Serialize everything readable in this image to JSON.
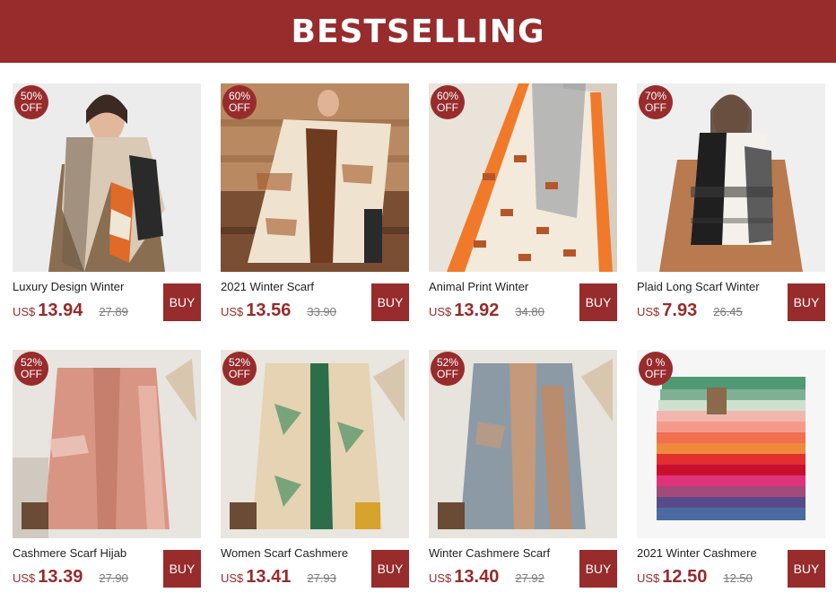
{
  "banner": {
    "title": "BESTSELLING"
  },
  "currency": "US$",
  "buy_label": "BUY",
  "colors": {
    "brand": "#982b2b"
  },
  "products": [
    {
      "badge_pct": "50%",
      "badge_off": "OFF",
      "title": "Luxury Design Winter",
      "price": "13.94",
      "original": "27.89",
      "image": "houndstooth-scarf-model"
    },
    {
      "badge_pct": "60%",
      "badge_off": "OFF",
      "title": "2021 Winter Scarf",
      "price": "13.56",
      "original": "33.90",
      "image": "horse-print-scarf-stairs"
    },
    {
      "badge_pct": "60%",
      "badge_off": "OFF",
      "title": "Animal Print Winter",
      "price": "13.92",
      "original": "34.80",
      "image": "animal-print-scarf"
    },
    {
      "badge_pct": "70%",
      "badge_off": "OFF",
      "title": "Plaid Long Scarf Winter",
      "price": "7.93",
      "original": "26.45",
      "image": "plaid-scarf-model"
    },
    {
      "badge_pct": "52%",
      "badge_off": "OFF",
      "title": "Cashmere Scarf Hijab",
      "price": "13.39",
      "original": "27.90",
      "image": "pink-cashmere-scarf"
    },
    {
      "badge_pct": "52%",
      "badge_off": "OFF",
      "title": "Women Scarf Cashmere",
      "price": "13.41",
      "original": "27.93",
      "image": "green-floral-scarf"
    },
    {
      "badge_pct": "52%",
      "badge_off": "OFF",
      "title": "Winter Cashmere Scarf",
      "price": "13.40",
      "original": "27.92",
      "image": "blue-cashmere-scarf"
    },
    {
      "badge_pct": "0 %",
      "badge_off": "OFF",
      "title": "2021 Winter Cashmere",
      "price": "12.50",
      "original": "12.50",
      "image": "stacked-color-scarves"
    }
  ]
}
